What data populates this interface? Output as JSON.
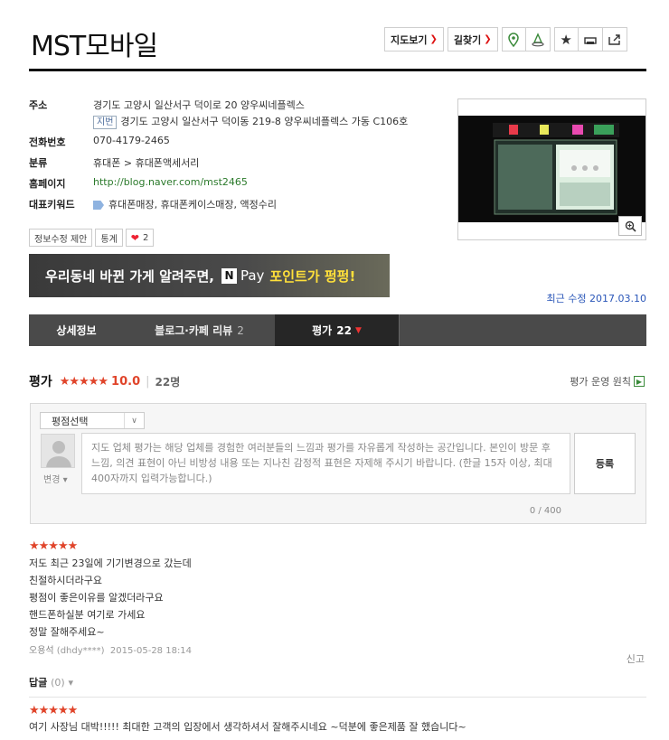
{
  "place": {
    "title": "MST모바일",
    "map_btn": "지도보기",
    "route_btn": "길찾기"
  },
  "info": {
    "address_label": "주소",
    "address": "경기도 고양시 일산서구 덕이로 20 양우씨네플렉스",
    "jibun_tag": "지번",
    "jibun": "경기도 고양시 일산서구 덕이동 219-8 양우씨네플렉스 가동 C106호",
    "phone_label": "전화번호",
    "phone": "070-4179-2465",
    "category_label": "분류",
    "category": "휴대폰 > 휴대폰액세서리",
    "homepage_label": "홈페이지",
    "homepage": "http://blog.naver.com/mst2465",
    "keywords_label": "대표키워드",
    "keywords": "휴대폰매장, 휴대폰케이스매장, 액정수리"
  },
  "actions": {
    "edit_suggest": "정보수정 제안",
    "stats": "통계",
    "likes": "2"
  },
  "banner": {
    "text1": "우리동네 바뀐 가게 알려주면,",
    "npay_n": "N",
    "pay": "Pay",
    "highlight": "포인트가 펑펑!"
  },
  "updated": "최근 수정 2017.03.10",
  "tabs": [
    {
      "label": "상세정보",
      "count": ""
    },
    {
      "label": "블로그·카페 리뷰",
      "count": "2"
    },
    {
      "label": "평가",
      "count": "22"
    }
  ],
  "rating": {
    "heading": "평가",
    "stars": "★★★★★",
    "score": "10.0",
    "count": "22명",
    "policy": "평가 운영 원칙"
  },
  "form": {
    "select": "평점선택",
    "change": "변경",
    "placeholder": "지도 업체 평가는 해당 업체를 경험한 여러분들의 느낌과 평가를 자유롭게 작성하는 공간입니다. 본인이 방문 후 느낌, 의견 표현이 아닌 비방성 내용 또는 지나친 감정적 표현은 자제해 주시기 바랍니다. (한글 15자 이상, 최대 400자까지 입력가능합니다.)",
    "submit": "등록",
    "counter": "0 / 400"
  },
  "reviews": [
    {
      "stars": "★★★★★",
      "lines": [
        "저도 최근 23일에 기기변경으로 갔는데",
        "친절하시더라구요",
        "평점이 좋은이유를 알겠더라구요",
        "핸드폰하실분 여기로 가세요",
        "정말 잘해주세요~"
      ],
      "author": "오용석",
      "author_id": "(dhdy****)",
      "date": "2015-05-28 18:14",
      "report": "신고",
      "reply": "답글",
      "reply_count": "(0)"
    },
    {
      "stars": "★★★★★",
      "lines": [
        "여기 사장님 대박!!!!! 최대한 고객의 입장에서 생각하셔서 잘해주시네요 ~덕분에 좋은제품 잘 했습니다~"
      ]
    }
  ]
}
